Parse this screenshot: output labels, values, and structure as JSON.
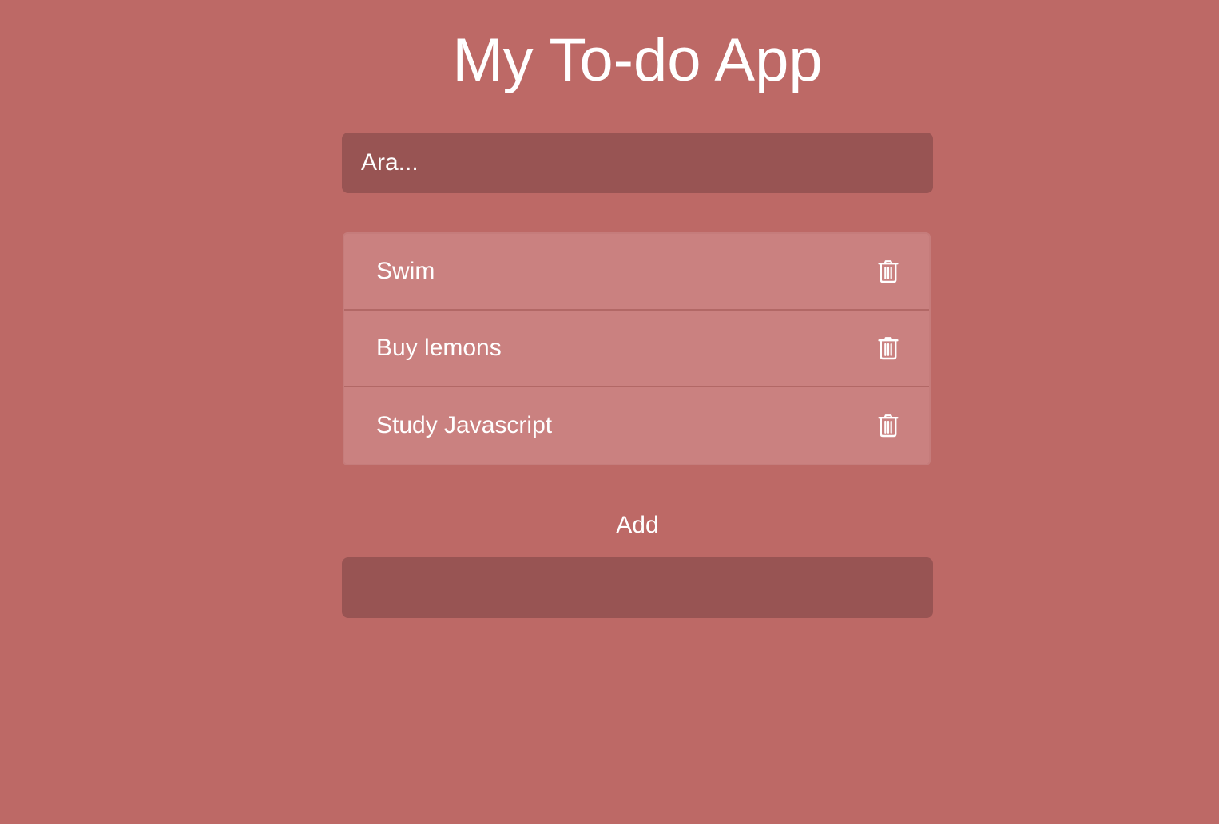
{
  "header": {
    "title": "My To-do App"
  },
  "search": {
    "placeholder": "Ara...",
    "value": ""
  },
  "todos": [
    {
      "text": "Swim",
      "delete_icon": "trash-icon"
    },
    {
      "text": "Buy lemons",
      "delete_icon": "trash-icon"
    },
    {
      "text": "Study Javascript",
      "delete_icon": "trash-icon"
    }
  ],
  "add": {
    "label": "Add",
    "value": "",
    "placeholder": ""
  },
  "colors": {
    "background": "#bd6966",
    "input_background": "#985453",
    "list_item_background": "#ca8180",
    "text": "#ffffff"
  }
}
